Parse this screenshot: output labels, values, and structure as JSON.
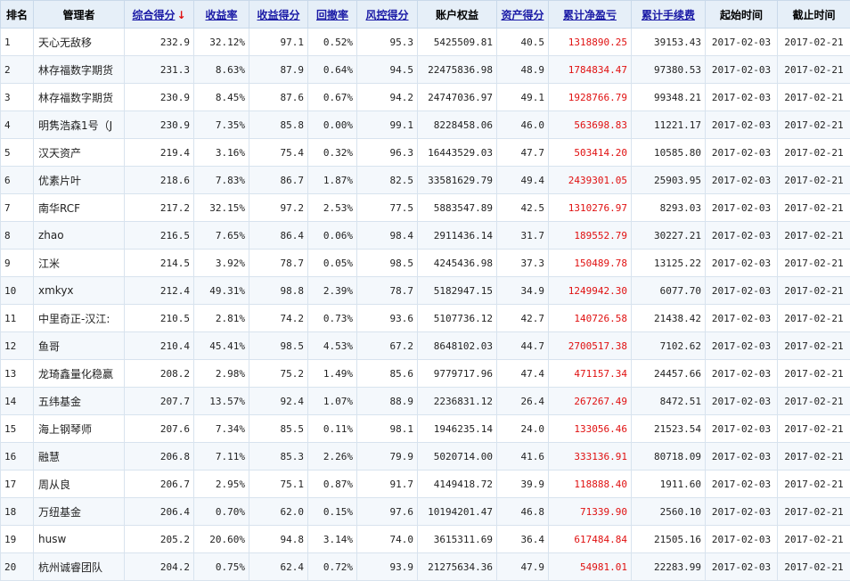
{
  "columns": [
    {
      "key": "rank",
      "label": "排名",
      "link": false
    },
    {
      "key": "manager",
      "label": "管理者",
      "link": false
    },
    {
      "key": "score",
      "label": "综合得分",
      "link": true,
      "sort_indicator": "↓"
    },
    {
      "key": "return_rate",
      "label": "收益率",
      "link": true
    },
    {
      "key": "return_score",
      "label": "收益得分",
      "link": true
    },
    {
      "key": "drawdown",
      "label": "回撤率",
      "link": true
    },
    {
      "key": "risk_score",
      "label": "风控得分",
      "link": true
    },
    {
      "key": "equity",
      "label": "账户权益",
      "link": false
    },
    {
      "key": "asset_score",
      "label": "资产得分",
      "link": true
    },
    {
      "key": "net_profit",
      "label": "累计净盈亏",
      "link": true
    },
    {
      "key": "fees",
      "label": "累计手续费",
      "link": true
    },
    {
      "key": "start",
      "label": "起始时间",
      "link": false
    },
    {
      "key": "end",
      "label": "截止时间",
      "link": false
    }
  ],
  "colors": {
    "header_bg": "#e6eff8",
    "link": "#1a1aa6",
    "profit": "#e01010",
    "border": "#d8e3ee"
  },
  "rows": [
    [
      "1",
      "天心无敌移",
      "232.9",
      "32.12%",
      "97.1",
      "0.52%",
      "95.3",
      "5425509.81",
      "40.5",
      "1318890.25",
      "39153.43",
      "2017-02-03",
      "2017-02-21"
    ],
    [
      "2",
      "林存福数字期货",
      "231.3",
      "8.63%",
      "87.9",
      "0.64%",
      "94.5",
      "22475836.98",
      "48.9",
      "1784834.47",
      "97380.53",
      "2017-02-03",
      "2017-02-21"
    ],
    [
      "3",
      "林存福数字期货",
      "230.9",
      "8.45%",
      "87.6",
      "0.67%",
      "94.2",
      "24747036.97",
      "49.1",
      "1928766.79",
      "99348.21",
      "2017-02-03",
      "2017-02-21"
    ],
    [
      "4",
      "明隽浩森1号（J",
      "230.9",
      "7.35%",
      "85.8",
      "0.00%",
      "99.1",
      "8228458.06",
      "46.0",
      "563698.83",
      "11221.17",
      "2017-02-03",
      "2017-02-21"
    ],
    [
      "5",
      "汉天资产",
      "219.4",
      "3.16%",
      "75.4",
      "0.32%",
      "96.3",
      "16443529.03",
      "47.7",
      "503414.20",
      "10585.80",
      "2017-02-03",
      "2017-02-21"
    ],
    [
      "6",
      "优素片叶",
      "218.6",
      "7.83%",
      "86.7",
      "1.87%",
      "82.5",
      "33581629.79",
      "49.4",
      "2439301.05",
      "25903.95",
      "2017-02-03",
      "2017-02-21"
    ],
    [
      "7",
      "南华RCF",
      "217.2",
      "32.15%",
      "97.2",
      "2.53%",
      "77.5",
      "5883547.89",
      "42.5",
      "1310276.97",
      "8293.03",
      "2017-02-03",
      "2017-02-21"
    ],
    [
      "8",
      "zhao",
      "216.5",
      "7.65%",
      "86.4",
      "0.06%",
      "98.4",
      "2911436.14",
      "31.7",
      "189552.79",
      "30227.21",
      "2017-02-03",
      "2017-02-21"
    ],
    [
      "9",
      "江米",
      "214.5",
      "3.92%",
      "78.7",
      "0.05%",
      "98.5",
      "4245436.98",
      "37.3",
      "150489.78",
      "13125.22",
      "2017-02-03",
      "2017-02-21"
    ],
    [
      "10",
      "xmkyx",
      "212.4",
      "49.31%",
      "98.8",
      "2.39%",
      "78.7",
      "5182947.15",
      "34.9",
      "1249942.30",
      "6077.70",
      "2017-02-03",
      "2017-02-21"
    ],
    [
      "11",
      "中里奇正-汉江:",
      "210.5",
      "2.81%",
      "74.2",
      "0.73%",
      "93.6",
      "5107736.12",
      "42.7",
      "140726.58",
      "21438.42",
      "2017-02-03",
      "2017-02-21"
    ],
    [
      "12",
      "鱼哥",
      "210.4",
      "45.41%",
      "98.5",
      "4.53%",
      "67.2",
      "8648102.03",
      "44.7",
      "2700517.38",
      "7102.62",
      "2017-02-03",
      "2017-02-21"
    ],
    [
      "13",
      "龙琦鑫量化稳赢",
      "208.2",
      "2.98%",
      "75.2",
      "1.49%",
      "85.6",
      "9779717.96",
      "47.4",
      "471157.34",
      "24457.66",
      "2017-02-03",
      "2017-02-21"
    ],
    [
      "14",
      "五纬基金",
      "207.7",
      "13.57%",
      "92.4",
      "1.07%",
      "88.9",
      "2236831.12",
      "26.4",
      "267267.49",
      "8472.51",
      "2017-02-03",
      "2017-02-21"
    ],
    [
      "15",
      "海上钢琴师",
      "207.6",
      "7.34%",
      "85.5",
      "0.11%",
      "98.1",
      "1946235.14",
      "24.0",
      "133056.46",
      "21523.54",
      "2017-02-03",
      "2017-02-21"
    ],
    [
      "16",
      "融慧",
      "206.8",
      "7.11%",
      "85.3",
      "2.26%",
      "79.9",
      "5020714.00",
      "41.6",
      "333136.91",
      "80718.09",
      "2017-02-03",
      "2017-02-21"
    ],
    [
      "17",
      "周从良",
      "206.7",
      "2.95%",
      "75.1",
      "0.87%",
      "91.7",
      "4149418.72",
      "39.9",
      "118888.40",
      "1911.60",
      "2017-02-03",
      "2017-02-21"
    ],
    [
      "18",
      "万纽基金",
      "206.4",
      "0.70%",
      "62.0",
      "0.15%",
      "97.6",
      "10194201.47",
      "46.8",
      "71339.90",
      "2560.10",
      "2017-02-03",
      "2017-02-21"
    ],
    [
      "19",
      "husw",
      "205.2",
      "20.60%",
      "94.8",
      "3.14%",
      "74.0",
      "3615311.69",
      "36.4",
      "617484.84",
      "21505.16",
      "2017-02-03",
      "2017-02-21"
    ],
    [
      "20",
      "杭州诚睿团队",
      "204.2",
      "0.75%",
      "62.4",
      "0.72%",
      "93.9",
      "21275634.36",
      "47.9",
      "54981.01",
      "22283.99",
      "2017-02-03",
      "2017-02-21"
    ]
  ]
}
